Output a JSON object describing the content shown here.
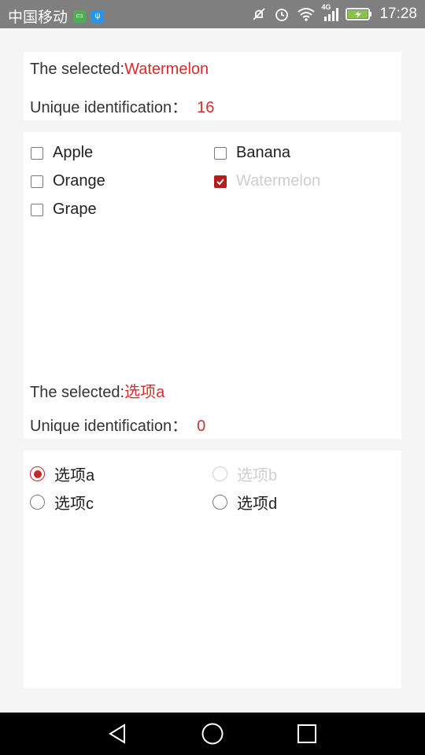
{
  "status_bar": {
    "carrier": "中国移动",
    "network": "4G",
    "time": "17:28",
    "icons": [
      "sim-icon",
      "usb-icon",
      "mute-icon",
      "alarm-icon",
      "wifi-icon",
      "signal-icon",
      "battery-charging-icon"
    ]
  },
  "checkbox_section": {
    "selected_label": "The selected:",
    "selected_value": "Watermelon",
    "id_label": "Unique identification：",
    "id_value": "16",
    "options": [
      {
        "label": "Apple",
        "checked": false,
        "disabled": false
      },
      {
        "label": "Banana",
        "checked": false,
        "disabled": false
      },
      {
        "label": "Orange",
        "checked": false,
        "disabled": false
      },
      {
        "label": "Watermelon",
        "checked": true,
        "disabled": true
      },
      {
        "label": "Grape",
        "checked": false,
        "disabled": false
      }
    ]
  },
  "radio_section": {
    "selected_label": "The selected:",
    "selected_value": "选项a",
    "id_label": "Unique identification：",
    "id_value": "0",
    "options": [
      {
        "label": "选项a",
        "checked": true,
        "disabled": false
      },
      {
        "label": "选项b",
        "checked": false,
        "disabled": true
      },
      {
        "label": "选项c",
        "checked": false,
        "disabled": false
      },
      {
        "label": "选项d",
        "checked": false,
        "disabled": false
      }
    ]
  },
  "colors": {
    "accent": "#c62828",
    "highlight_text": "#d32f2f",
    "status_bar": "#7f7f7f",
    "nav_bar": "#000000"
  },
  "nav_bar": {
    "icons": [
      "back-icon",
      "home-icon",
      "recents-icon"
    ]
  }
}
